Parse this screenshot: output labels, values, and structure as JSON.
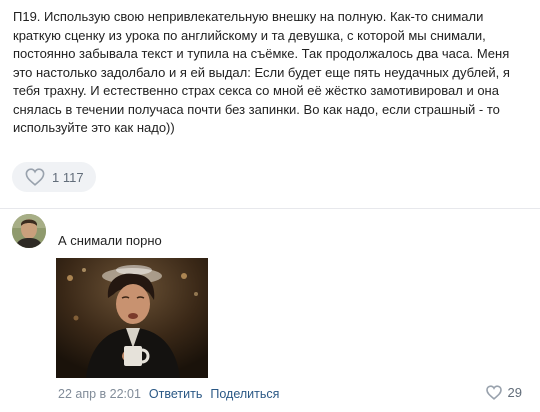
{
  "post": {
    "lines": [
      "П19. Использую свою непривлекательную внешку на полную. Как-то снимали",
      "краткую сценку из урока по английскому и та девушка, с которой мы снимали,",
      "постоянно забывала текст и тупила на съёмке. Так продолжалось два часа. Меня",
      "это настолько задолбало и я ей выдал: Если будет еще пять неудачных дублей, я",
      "тебя трахну. И естественно страх секса со мной её жёстко замотивировал и она",
      "снялась в течении получаса почти без запинки. Во как надо, если страшный - то",
      "используйте это как надо))"
    ],
    "likes": "1 117",
    "heart_icon": "heart-outline-icon"
  },
  "comment": {
    "text": "А снимали порно",
    "date": "22 апр в 22:01",
    "reply_label": "Ответить",
    "share_label": "Поделиться",
    "likes": "29"
  },
  "colors": {
    "text": "#222222",
    "muted": "#818c99",
    "link": "#2a5885",
    "pill": "#f0f2f5",
    "icon": "#99a2ad"
  }
}
